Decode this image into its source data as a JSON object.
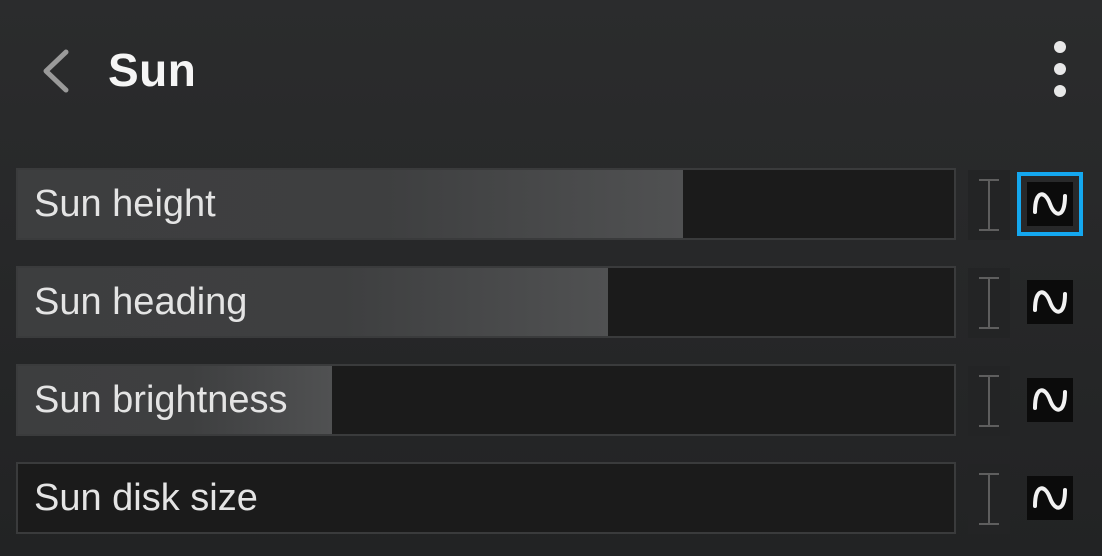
{
  "header": {
    "title": "Sun",
    "back_icon": "chevron-left-icon",
    "menu_icon": "vertical-ellipsis-icon"
  },
  "sliders": [
    {
      "label": "Sun height",
      "value_fraction": 0.71,
      "selected_anim": true
    },
    {
      "label": "Sun heading",
      "value_fraction": 0.63,
      "selected_anim": false
    },
    {
      "label": "Sun brightness",
      "value_fraction": 0.335,
      "selected_anim": false
    },
    {
      "label": "Sun disk size",
      "value_fraction": 0.0,
      "selected_anim": false
    }
  ],
  "icons": {
    "handle": "text-cursor-handle-icon",
    "animate": "sine-wave-icon"
  },
  "colors": {
    "selection_outline": "#14a8f0",
    "background": "#262728"
  }
}
